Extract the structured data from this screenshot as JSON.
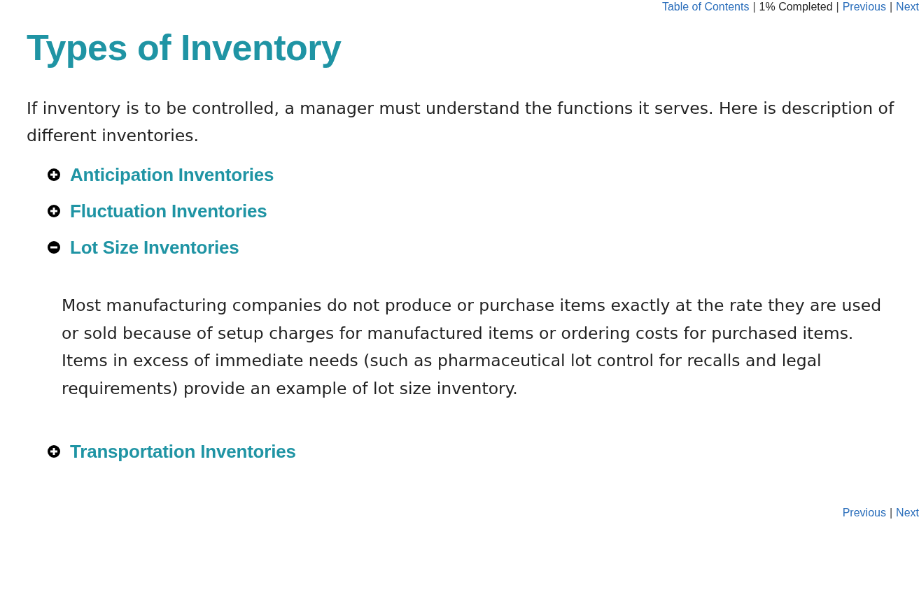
{
  "top_nav": [
    {
      "kind": "link",
      "text": "Table of Contents"
    },
    {
      "kind": "separator",
      "text": "|"
    },
    {
      "kind": "text",
      "text": "1% Completed"
    },
    {
      "kind": "separator",
      "text": "|"
    },
    {
      "kind": "link",
      "text": "Previous"
    },
    {
      "kind": "separator",
      "text": "|"
    },
    {
      "kind": "link",
      "text": "Next"
    }
  ],
  "title": "Types of Inventory",
  "intro": "If inventory is to be controlled, a manager must understand the functions it serves. Here is description of different inventories.",
  "sections": [
    {
      "title": "Anticipation Inventories",
      "expanded": false
    },
    {
      "title": "Fluctuation Inventories",
      "expanded": false
    },
    {
      "title": "Lot Size Inventories",
      "expanded": true,
      "body": "Most manufacturing companies do not produce or purchase items exactly at the rate they are used or sold because of setup charges for manufactured items or ordering costs for purchased items. Items in excess of immediate needs (such as pharmaceutical lot control for recalls and legal requirements) provide an example of lot size inventory."
    },
    {
      "title": "Transportation Inventories",
      "expanded": false
    }
  ],
  "bottom_nav": [
    {
      "kind": "link",
      "text": "Previous"
    },
    {
      "kind": "separator",
      "text": "|"
    },
    {
      "kind": "link",
      "text": "Next"
    }
  ]
}
